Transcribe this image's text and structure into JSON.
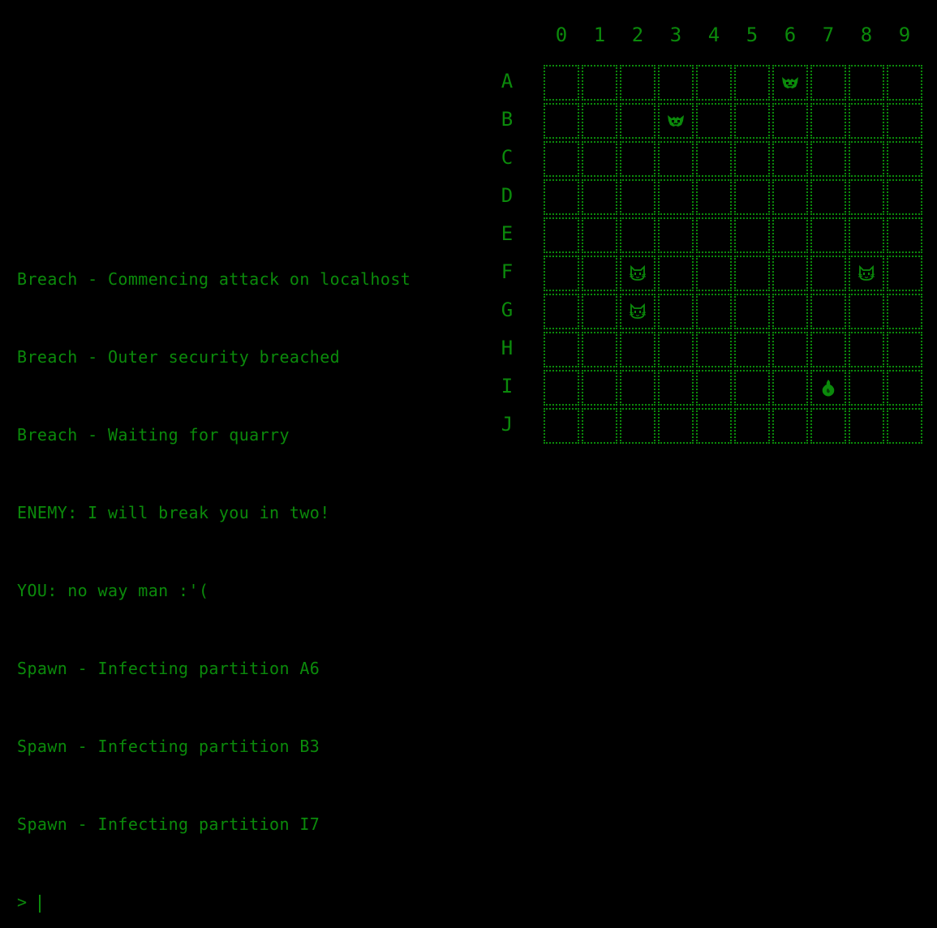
{
  "colors": {
    "background": "#000000",
    "foreground": "#0b8a0b"
  },
  "terminal": {
    "lines": [
      "Breach - Commencing attack on localhost",
      "Breach - Outer security breached",
      "Breach - Waiting for quarry",
      "ENEMY: I will break you in two!",
      "YOU: no way man :'(",
      "Spawn - Infecting partition A6",
      "Spawn - Infecting partition B3",
      "Spawn - Infecting partition I7"
    ],
    "prompt": "> "
  },
  "board": {
    "columns": [
      "0",
      "1",
      "2",
      "3",
      "4",
      "5",
      "6",
      "7",
      "8",
      "9"
    ],
    "rows": [
      "A",
      "B",
      "C",
      "D",
      "E",
      "F",
      "G",
      "H",
      "I",
      "J"
    ],
    "pieces": [
      {
        "cell": "A6",
        "icon": "bat-face-icon"
      },
      {
        "cell": "B3",
        "icon": "bat-face-icon"
      },
      {
        "cell": "F2",
        "icon": "cat-face-icon"
      },
      {
        "cell": "F8",
        "icon": "cat-face-icon"
      },
      {
        "cell": "G2",
        "icon": "cat-face-icon"
      },
      {
        "cell": "I7",
        "icon": "flame-icon"
      }
    ]
  }
}
